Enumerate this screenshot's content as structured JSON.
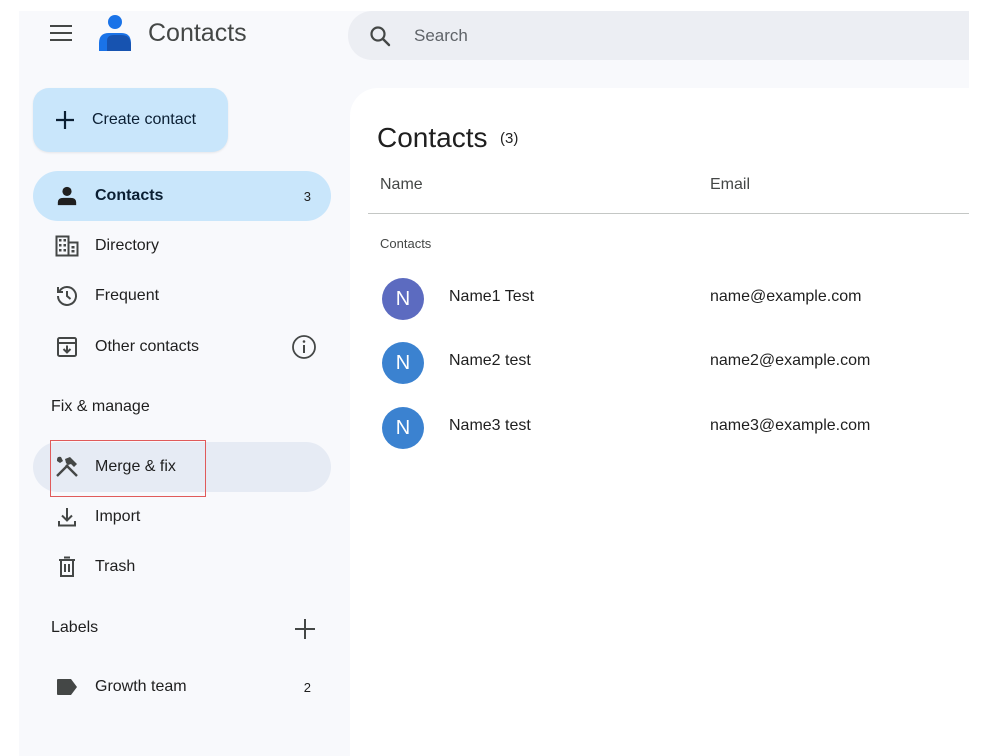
{
  "header": {
    "app_title": "Contacts",
    "search_placeholder": "Search",
    "icons": {
      "menu": "hamburger-menu-icon",
      "logo": "contacts-logo-icon",
      "search": "search-icon"
    }
  },
  "sidebar": {
    "create_label": "Create contact",
    "items": [
      {
        "label": "Contacts",
        "count": "3",
        "icon": "person-icon",
        "active": true
      },
      {
        "label": "Directory",
        "icon": "building-icon"
      },
      {
        "label": "Frequent",
        "icon": "history-icon"
      },
      {
        "label": "Other contacts",
        "icon": "archive-download-icon",
        "extra_icon": "info-icon"
      }
    ],
    "fix_manage_heading": "Fix & manage",
    "fix_items": [
      {
        "label": "Merge & fix",
        "icon": "merge-fix-tools-icon",
        "hover": true
      },
      {
        "label": "Import",
        "icon": "download-icon"
      },
      {
        "label": "Trash",
        "icon": "trash-icon"
      }
    ],
    "labels_heading": "Labels",
    "labels": [
      {
        "label": "Growth team",
        "count": "2",
        "icon": "label-tag-icon"
      }
    ]
  },
  "main": {
    "title": "Contacts",
    "count": "(3)",
    "columns": {
      "name": "Name",
      "email": "Email"
    },
    "group_label": "Contacts",
    "rows": [
      {
        "initial": "N",
        "name": "Name1 Test",
        "email": "name@example.com",
        "avatar_color": "#5c6bc0"
      },
      {
        "initial": "N",
        "name": "Name2 test",
        "email": "name2@example.com",
        "avatar_color": "#3b82d0"
      },
      {
        "initial": "N",
        "name": "Name3 test",
        "email": "name3@example.com",
        "avatar_color": "#3b82d0"
      }
    ]
  },
  "colors": {
    "accent": "#c9e6fb",
    "background": "#f8f9fc",
    "hover": "#e6ebf4",
    "highlight_border": "#e05a5a"
  }
}
